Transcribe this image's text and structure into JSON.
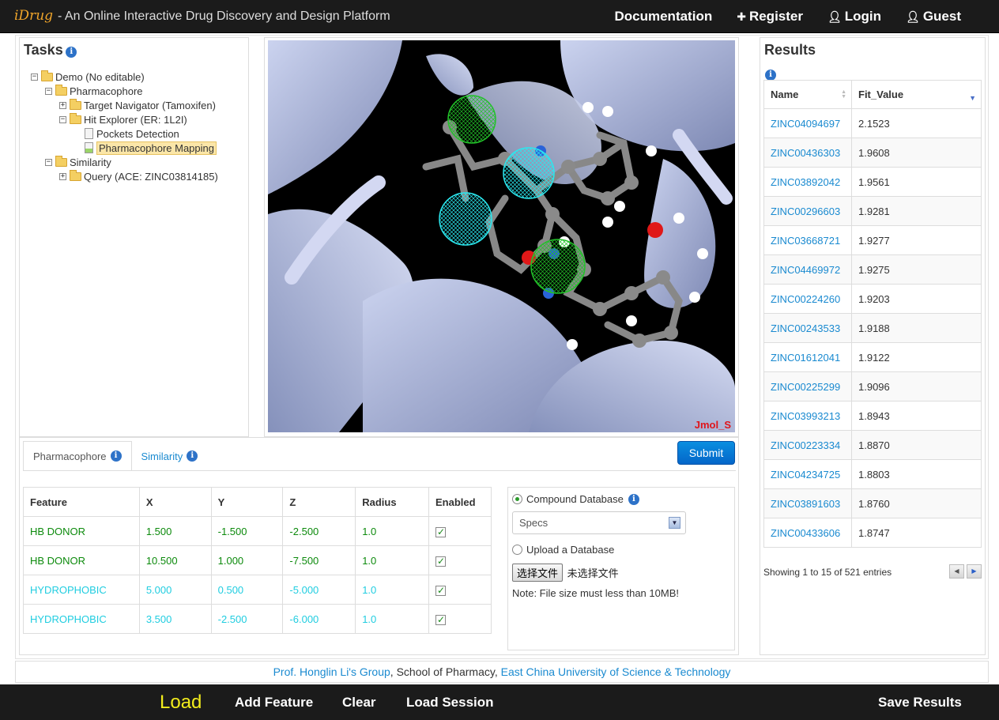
{
  "header": {
    "logo": "iDrug",
    "tagline": "- An Online Interactive Drug Discovery and Design Platform",
    "nav": [
      {
        "label": "Documentation",
        "icon": ""
      },
      {
        "label": "Register",
        "icon": "plus-icon"
      },
      {
        "label": "Login",
        "icon": "user-icon"
      },
      {
        "label": "Guest",
        "icon": "user-icon"
      }
    ]
  },
  "tasks": {
    "title": "Tasks",
    "tree": {
      "demo": "Demo (No editable)",
      "pharmacophore": "Pharmacophore",
      "target_navigator": "Target Navigator (Tamoxifen)",
      "hit_explorer": "Hit Explorer (ER: 1L2I)",
      "pockets_detection": "Pockets Detection",
      "pharmacophore_mapping": "Pharmacophore Mapping",
      "similarity": "Similarity",
      "query": "Query (ACE: ZINC03814185)"
    }
  },
  "viewer": {
    "label": "Jmol_S"
  },
  "tabs": [
    {
      "label": "Pharmacophore"
    },
    {
      "label": "Similarity"
    }
  ],
  "submit_label": "Submit",
  "features": {
    "headers": [
      "Feature",
      "X",
      "Y",
      "Z",
      "Radius",
      "Enabled"
    ],
    "rows": [
      {
        "feature": "HB DONOR",
        "x": "1.500",
        "y": "-1.500",
        "z": "-2.500",
        "radius": "1.0",
        "type": "donor"
      },
      {
        "feature": "HB DONOR",
        "x": "10.500",
        "y": "1.000",
        "z": "-7.500",
        "radius": "1.0",
        "type": "donor"
      },
      {
        "feature": "HYDROPHOBIC",
        "x": "5.000",
        "y": "0.500",
        "z": "-5.000",
        "radius": "1.0",
        "type": "hydro"
      },
      {
        "feature": "HYDROPHOBIC",
        "x": "3.500",
        "y": "-2.500",
        "z": "-6.000",
        "radius": "1.0",
        "type": "hydro"
      }
    ]
  },
  "database": {
    "compound_label": "Compound Database",
    "selected_db": "Specs",
    "upload_label": "Upload a Database",
    "file_button": "选择文件",
    "file_status": "未选择文件",
    "note": "Note: File size must less than 10MB!"
  },
  "results": {
    "title": "Results",
    "headers": [
      "Name",
      "Fit_Value"
    ],
    "rows": [
      {
        "name": "ZINC04094697",
        "fit": "2.1523"
      },
      {
        "name": "ZINC00436303",
        "fit": "1.9608"
      },
      {
        "name": "ZINC03892042",
        "fit": "1.9561"
      },
      {
        "name": "ZINC00296603",
        "fit": "1.9281"
      },
      {
        "name": "ZINC03668721",
        "fit": "1.9277"
      },
      {
        "name": "ZINC04469972",
        "fit": "1.9275"
      },
      {
        "name": "ZINC00224260",
        "fit": "1.9203"
      },
      {
        "name": "ZINC00243533",
        "fit": "1.9188"
      },
      {
        "name": "ZINC01612041",
        "fit": "1.9122"
      },
      {
        "name": "ZINC00225299",
        "fit": "1.9096"
      },
      {
        "name": "ZINC03993213",
        "fit": "1.8943"
      },
      {
        "name": "ZINC00223334",
        "fit": "1.8870"
      },
      {
        "name": "ZINC04234725",
        "fit": "1.8803"
      },
      {
        "name": "ZINC03891603",
        "fit": "1.8760"
      },
      {
        "name": "ZINC00433606",
        "fit": "1.8747"
      }
    ],
    "info": "Showing 1 to 15 of 521 entries"
  },
  "footer": {
    "group_link": "Prof. Honglin Li's Group",
    "school": ", School of Pharmacy, ",
    "university_link": "East China University of Science & Technology"
  },
  "toolbar": {
    "load": "Load",
    "add_feature": "Add Feature",
    "clear": "Clear",
    "load_session": "Load Session",
    "save_results": "Save Results"
  }
}
